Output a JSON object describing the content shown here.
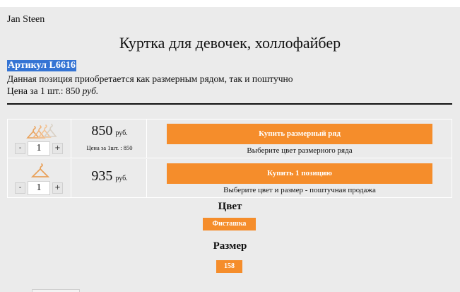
{
  "shop": {
    "name": "Jan Steen"
  },
  "product": {
    "title": "Куртка для девочек, холлофайбер",
    "sku": "Артикул L6616",
    "description": "Данная позиция приобретается как размерным рядом, так и поштучно",
    "unit_price_label": "Цена за 1 шт.: 850",
    "unit_price_currency": "руб."
  },
  "rows": [
    {
      "quantity": "1",
      "price": "850",
      "currency": "руб.",
      "price_note": "Цена за 1шт. : 850",
      "button_label": "Купить размерный ряд",
      "hint": "Выберите цвет размерного ряда",
      "minus_label": "-",
      "plus_label": "+"
    },
    {
      "quantity": "1",
      "price": "935",
      "currency": "руб.",
      "button_label": "Купить 1 позицию",
      "hint": "Выберите цвет и размер - поштучная продажа",
      "minus_label": "-",
      "plus_label": "+"
    }
  ],
  "options": {
    "color_title": "Цвет",
    "color_value": "Фисташка",
    "size_title": "Размер",
    "size_value": "158"
  },
  "colors": {
    "accent": "#f58d2b",
    "selection": "#3574d4",
    "panel": "#ebebeb"
  }
}
